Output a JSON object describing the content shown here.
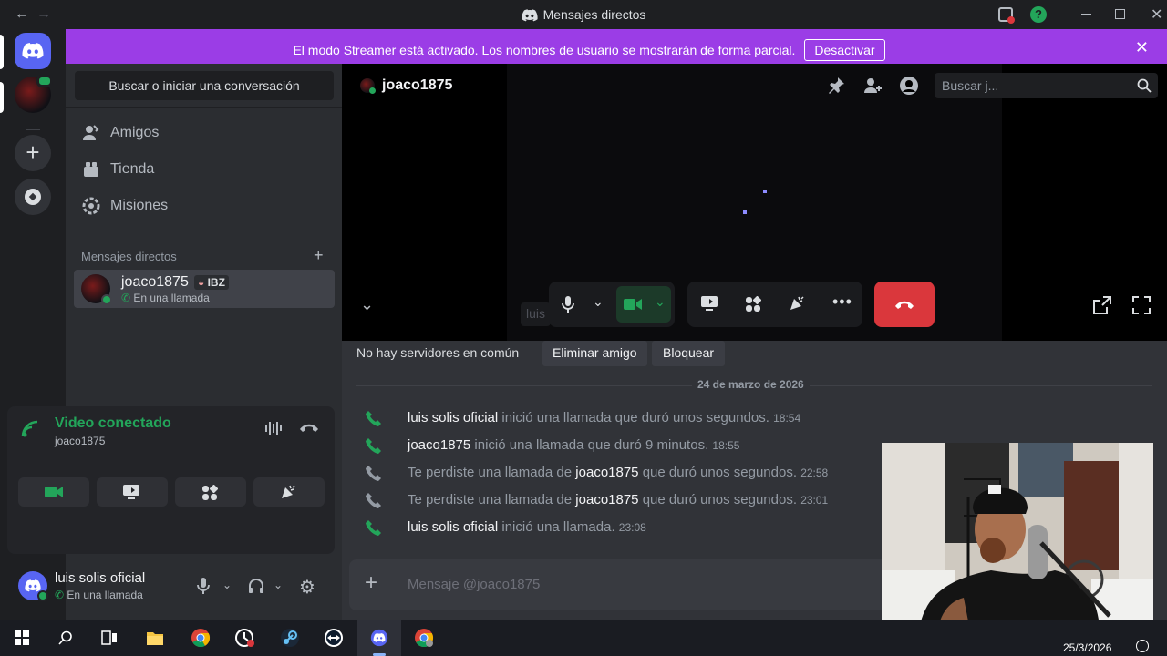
{
  "window": {
    "title": "Mensajes directos"
  },
  "banner": {
    "message": "El modo Streamer está activado. Los nombres de usuario se mostrarán de forma parcial.",
    "button": "Desactivar"
  },
  "sidebar": {
    "search_label": "Buscar o iniciar una conversación",
    "nav": [
      {
        "label": "Amigos",
        "icon": "friends-icon"
      },
      {
        "label": "Tienda",
        "icon": "shop-icon"
      },
      {
        "label": "Misiones",
        "icon": "quests-icon"
      }
    ],
    "dm_header": "Mensajes directos",
    "dm_items": [
      {
        "name": "joaco1875",
        "tag": "IBZ",
        "status": "En una llamada"
      }
    ]
  },
  "voice_panel": {
    "status": "Video conectado",
    "channel": "joaco1875"
  },
  "user_panel": {
    "name": "luis solis oficial",
    "status": "En una llamada"
  },
  "header": {
    "dm_name": "joaco1875",
    "search_placeholder": "Buscar j..."
  },
  "call": {
    "overlay_text": "luis"
  },
  "info_bar": {
    "no_servers": "No hay servidores en común",
    "remove_friend": "Eliminar amigo",
    "block": "Bloquear"
  },
  "chat": {
    "date_divider": "24 de marzo de 2026",
    "messages": [
      {
        "type": "outgoing",
        "name": "luis solis oficial",
        "text": "inició una llamada que duró unos segundos.",
        "time": "18:54",
        "color": "#23a55a"
      },
      {
        "type": "outgoing",
        "name": "joaco1875",
        "text": "inició una llamada que duró 9 minutos.",
        "time": "18:55",
        "color": "#23a55a"
      },
      {
        "type": "missed",
        "prefix": "Te perdiste una llamada de",
        "name": "joaco1875",
        "text": "que duró unos segundos.",
        "time": "22:58",
        "color": "#949ba4"
      },
      {
        "type": "missed",
        "prefix": "Te perdiste una llamada de",
        "name": "joaco1875",
        "text": "que duró unos segundos.",
        "time": "23:01",
        "color": "#949ba4"
      },
      {
        "type": "outgoing",
        "name": "luis solis oficial",
        "text": "inició una llamada.",
        "time": "23:08",
        "color": "#23a55a"
      }
    ],
    "composer_placeholder": "Mensaje @joaco1875"
  },
  "taskbar": {
    "date": "25/3/2026"
  },
  "colors": {
    "brand": "#5865f2",
    "banner": "#9b3de6",
    "green": "#23a55a",
    "hangup": "#da373c"
  }
}
